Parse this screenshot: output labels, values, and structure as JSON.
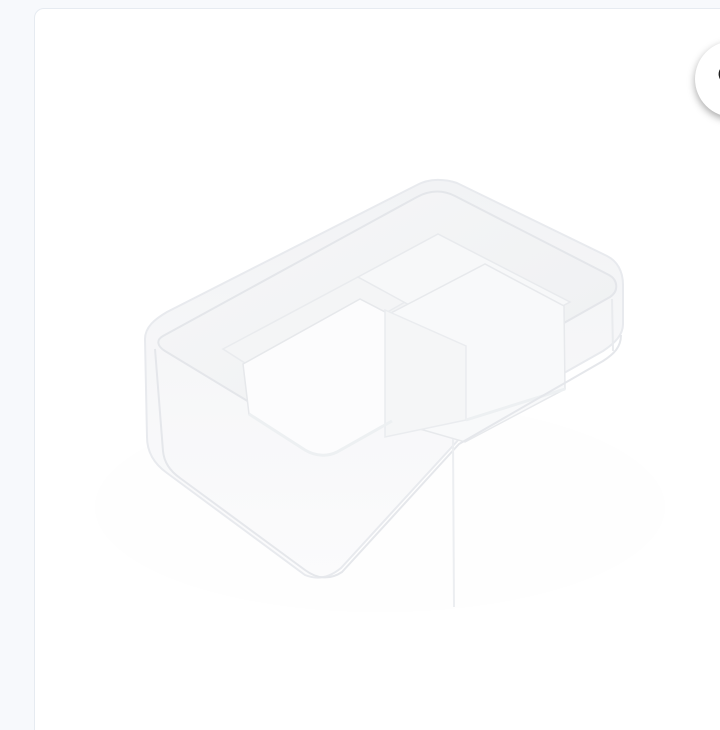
{
  "product": {
    "image_icon": "food-storage-container-image",
    "accent": "#ffffff",
    "background": "#f7f9fc"
  },
  "wishlist": {
    "icon": "heart-icon",
    "color": "#1f1f1f"
  }
}
